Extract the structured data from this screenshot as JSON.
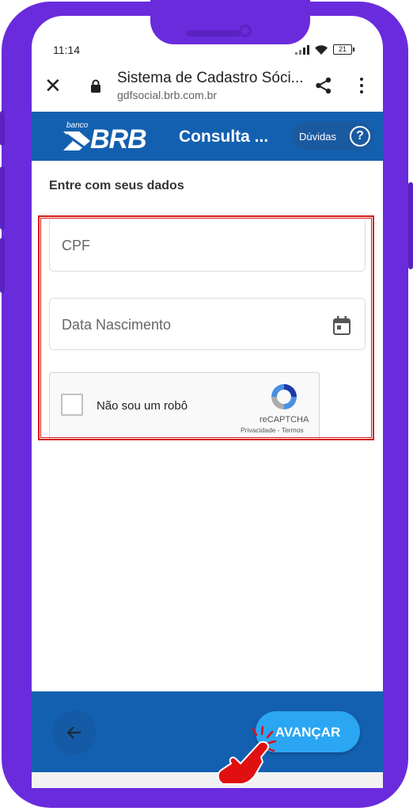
{
  "status_bar": {
    "time": "11:14",
    "battery": "21"
  },
  "browser": {
    "title": "Sistema de Cadastro Sóci...",
    "domain": "gdfsocial.brb.com.br",
    "icons": {
      "close": "close-icon",
      "lock": "lock-icon",
      "share": "share-icon",
      "menu": "more-vert-icon"
    }
  },
  "header": {
    "logo_small": "banco",
    "logo_main": "BRB",
    "title": "Consulta ...",
    "help_label": "Dúvidas",
    "help_glyph": "?"
  },
  "form": {
    "heading": "Entre com seus dados",
    "cpf": {
      "placeholder": "CPF",
      "value": ""
    },
    "birth_date": {
      "placeholder": "Data Nascimento",
      "value": ""
    },
    "recaptcha": {
      "label": "Não sou um robô",
      "brand": "reCAPTCHA",
      "links": "Privacidade - Termos",
      "checked": false
    }
  },
  "footer": {
    "next_label": "AVANÇAR",
    "back_icon": "arrow-left-icon"
  },
  "colors": {
    "frame": "#6a2bdc",
    "header_blue": "#1460b0",
    "button_blue": "#2aa6f2",
    "highlight_red": "#d41a1a",
    "hand_red": "#e01010"
  }
}
